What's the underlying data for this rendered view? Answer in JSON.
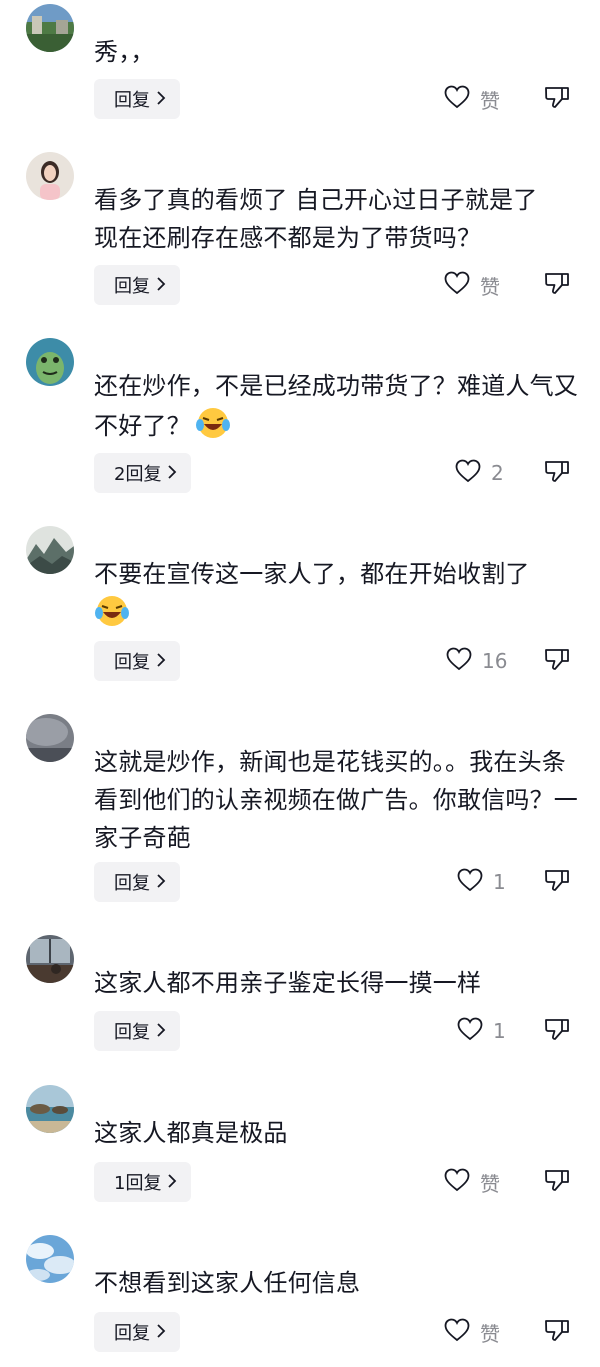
{
  "comments": [
    {
      "text": "秀，，",
      "reply_label": "回复",
      "like_label": "赞",
      "avatar": "green-landscape"
    },
    {
      "text": "看多了真的看烦了 自己开心过日子就是了 现在还刷存在感不都是为了带货吗？",
      "reply_label": "回复",
      "like_label": "赞",
      "avatar": "girl-portrait"
    },
    {
      "text": "还在炒作，不是已经成功带货了？难道人气又不好了？",
      "emoji": "laughing-crying-emoji",
      "reply_label": "2回复",
      "like_label": "2",
      "avatar": "green-frog"
    },
    {
      "text": "不要在宣传这一家人了，都在开始收割了",
      "emoji": "laughing-crying-emoji",
      "reply_label": "回复",
      "like_label": "16",
      "avatar": "ink-painting"
    },
    {
      "text": "这就是炒作，新闻也是花钱买的。。我在头条看到他们的认亲视频在做广告。你敢信吗？一家子奇葩",
      "reply_label": "回复",
      "like_label": "1",
      "avatar": "gray-sky"
    },
    {
      "text": "这家人都不用亲子鉴定长得一摸一样",
      "reply_label": "回复",
      "like_label": "1",
      "avatar": "window-room"
    },
    {
      "text": "这家人都真是极品",
      "reply_label": "1回复",
      "like_label": "赞",
      "avatar": "sea-rocks"
    },
    {
      "text": "不想看到这家人任何信息",
      "reply_label": "回复",
      "like_label": "赞",
      "avatar": "blue-clouds"
    }
  ],
  "colors": {
    "text": "#161823",
    "secondary": "#8a8b91",
    "reply_bg": "#f2f2f4"
  }
}
